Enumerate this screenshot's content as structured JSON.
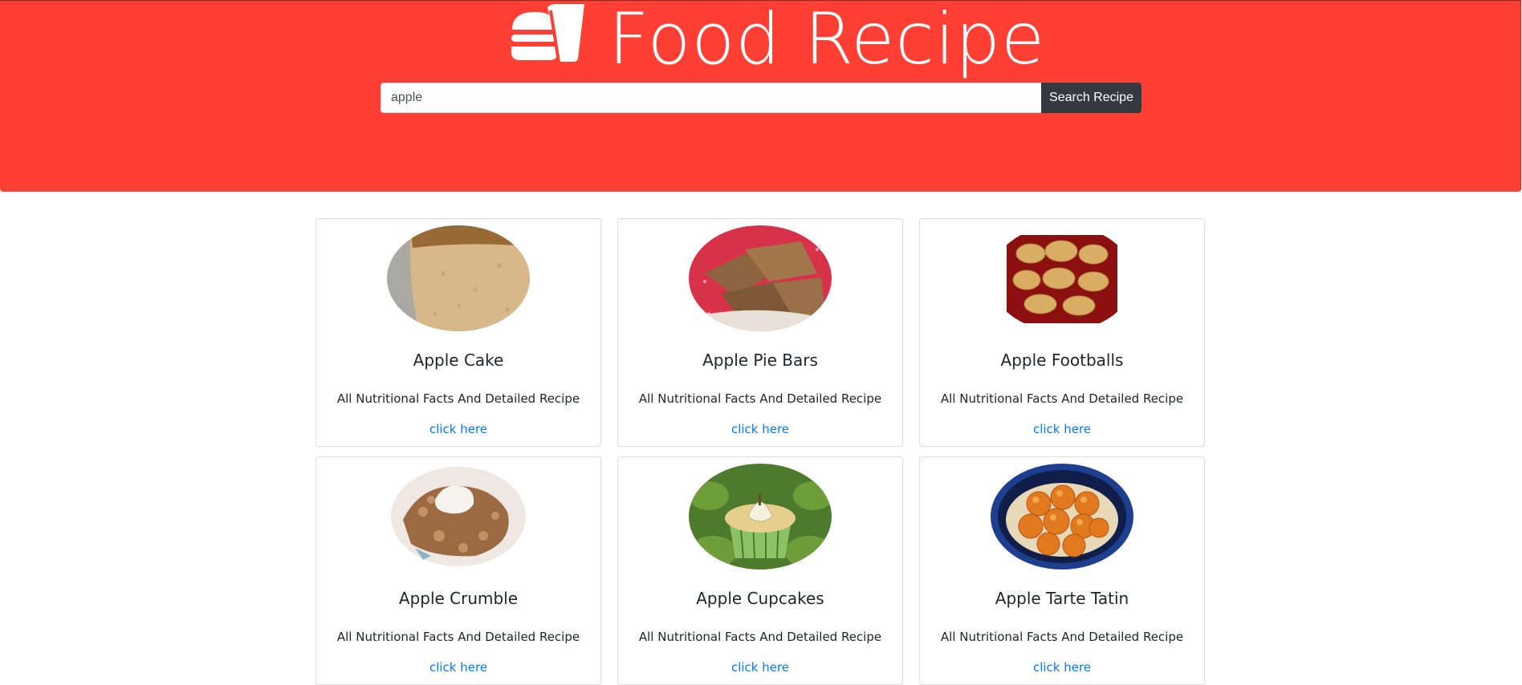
{
  "header": {
    "title": "Food Recipe",
    "logo_icon": "burger-drink-icon",
    "background_color": "#ff3f34"
  },
  "search": {
    "value": "apple",
    "placeholder": "",
    "button_label": "Search Recipe"
  },
  "recipes": [
    {
      "title": "Apple Cake",
      "description": "All Nutritional Facts And Detailed Recipe",
      "link_label": "click here",
      "image": "apple-cake-photo"
    },
    {
      "title": "Apple Pie Bars",
      "description": "All Nutritional Facts And Detailed Recipe",
      "link_label": "click here",
      "image": "apple-pie-bars-photo"
    },
    {
      "title": "Apple Footballs",
      "description": "All Nutritional Facts And Detailed Recipe",
      "link_label": "click here",
      "image": "apple-footballs-photo"
    },
    {
      "title": "Apple Crumble",
      "description": "All Nutritional Facts And Detailed Recipe",
      "link_label": "click here",
      "image": "apple-crumble-photo"
    },
    {
      "title": "Apple Cupcakes",
      "description": "All Nutritional Facts And Detailed Recipe",
      "link_label": "click here",
      "image": "apple-cupcakes-photo"
    },
    {
      "title": "Apple Tarte Tatin",
      "description": "All Nutritional Facts And Detailed Recipe",
      "link_label": "click here",
      "image": "apple-tarte-tatin-photo"
    }
  ],
  "colors": {
    "link": "#007bff",
    "button": "#343a40"
  }
}
